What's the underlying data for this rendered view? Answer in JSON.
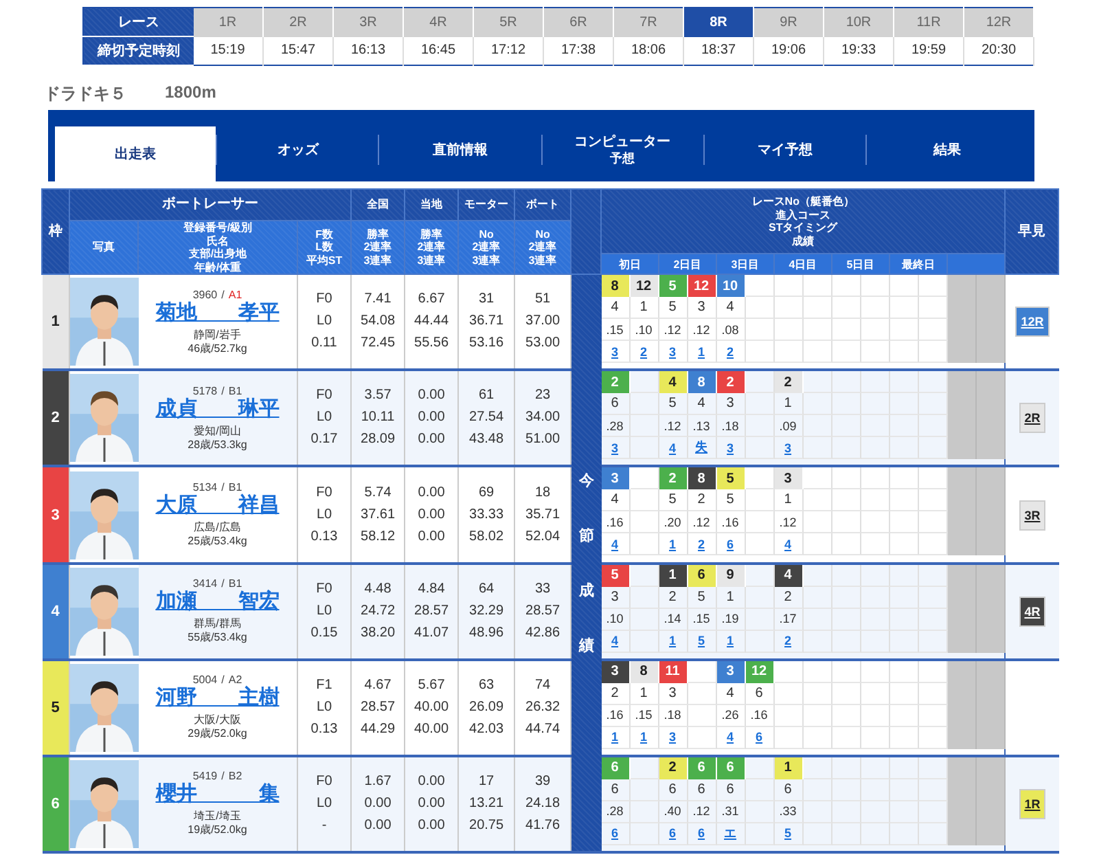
{
  "race_bar": {
    "race_label": "レース",
    "time_label": "締切予定時刻",
    "races": [
      {
        "label": "1R",
        "time": "15:19",
        "selected": false
      },
      {
        "label": "2R",
        "time": "15:47",
        "selected": false
      },
      {
        "label": "3R",
        "time": "16:13",
        "selected": false
      },
      {
        "label": "4R",
        "time": "16:45",
        "selected": false
      },
      {
        "label": "5R",
        "time": "17:12",
        "selected": false
      },
      {
        "label": "6R",
        "time": "17:38",
        "selected": false
      },
      {
        "label": "7R",
        "time": "18:06",
        "selected": false
      },
      {
        "label": "8R",
        "time": "18:37",
        "selected": true
      },
      {
        "label": "9R",
        "time": "19:06",
        "selected": false
      },
      {
        "label": "10R",
        "time": "19:33",
        "selected": false
      },
      {
        "label": "11R",
        "time": "19:59",
        "selected": false
      },
      {
        "label": "12R",
        "time": "20:30",
        "selected": false
      }
    ]
  },
  "race_title": {
    "name": "ドラドキ５",
    "distance": "1800m"
  },
  "tabs": [
    {
      "lines": [
        "出走表"
      ],
      "selected": true
    },
    {
      "lines": [
        "オッズ"
      ],
      "selected": false
    },
    {
      "lines": [
        "直前情報"
      ],
      "selected": false
    },
    {
      "lines": [
        "コンピューター",
        "予想"
      ],
      "selected": false
    },
    {
      "lines": [
        "マイ予想"
      ],
      "selected": false
    },
    {
      "lines": [
        "結果"
      ],
      "selected": false
    }
  ],
  "table": {
    "headers": {
      "waku": "枠",
      "racer": "ボートレーサー",
      "national": "全国",
      "local": "当地",
      "motor": "モーター",
      "boat": "ボート",
      "photo": "写真",
      "profile": [
        "登録番号/級別",
        "氏名",
        "支部/出身地",
        "年齢/体重"
      ],
      "fl": [
        "F数",
        "L数",
        "平均ST"
      ],
      "national_sub": [
        "勝率",
        "2連率",
        "3連率"
      ],
      "local_sub": [
        "勝率",
        "2連率",
        "3連率"
      ],
      "motor_sub": [
        "No",
        "2連率",
        "3連率"
      ],
      "boat_sub": [
        "No",
        "2連率",
        "3連率"
      ],
      "series": [
        "レースNo（艇番色）",
        "進入コース",
        "STタイミング",
        "成績"
      ],
      "days": [
        "初日",
        "2日目",
        "3日目",
        "4日目",
        "5日目",
        "最終日"
      ],
      "early": "早見"
    },
    "series_label": "今節成績",
    "racers": [
      {
        "waku": "1",
        "color": "#e6e6e6",
        "reg": "3960",
        "sep": "/",
        "klass": "A1",
        "klass_highlight": true,
        "name": "菊地　　孝平",
        "branch": "静岡/岩手",
        "age": "46歳/52.7kg",
        "fl": [
          "F0",
          "L0",
          "0.11"
        ],
        "national": [
          "7.41",
          "54.08",
          "72.45"
        ],
        "local": [
          "6.67",
          "44.44",
          "55.56"
        ],
        "motor": [
          "31",
          "36.71",
          "53.16"
        ],
        "boat": [
          "51",
          "37.00",
          "53.00"
        ],
        "races": [
          {
            "kind": "race",
            "no": "8",
            "color": "#e8e85a",
            "course": "4",
            "st": ".15",
            "result": "3"
          },
          {
            "kind": "race",
            "no": "12",
            "color": "#e6e6e6",
            "course": "1",
            "st": ".10",
            "result": "2"
          },
          {
            "kind": "race",
            "no": "5",
            "color": "#4cb04c",
            "course": "5",
            "st": ".12",
            "result": "3"
          },
          {
            "kind": "race",
            "no": "12",
            "color": "#e84444",
            "course": "3",
            "st": ".12",
            "result": "1"
          },
          {
            "kind": "race",
            "no": "10",
            "color": "#3f80d0",
            "course": "4",
            "st": ".08",
            "result": "2"
          }
        ],
        "early": {
          "label": "12R",
          "color": "#3f80d0"
        }
      },
      {
        "waku": "2",
        "color": "#444444",
        "reg": "5178",
        "sep": "/",
        "klass": "B1",
        "klass_highlight": false,
        "name": "成貞　　琳平",
        "branch": "愛知/岡山",
        "age": "28歳/53.3kg",
        "fl": [
          "F0",
          "L0",
          "0.17"
        ],
        "national": [
          "3.57",
          "10.11",
          "28.09"
        ],
        "local": [
          "0.00",
          "0.00",
          "0.00"
        ],
        "motor": [
          "61",
          "27.54",
          "43.48"
        ],
        "boat": [
          "23",
          "34.00",
          "51.00"
        ],
        "races": [
          {
            "kind": "race",
            "no": "2",
            "color": "#4cb04c",
            "course": "6",
            "st": ".28",
            "result": "3"
          },
          {
            "kind": "blank"
          },
          {
            "kind": "race",
            "no": "4",
            "color": "#e8e85a",
            "course": "5",
            "st": ".12",
            "result": "4"
          },
          {
            "kind": "race",
            "no": "8",
            "color": "#3f80d0",
            "course": "4",
            "st": ".13",
            "result": "失"
          },
          {
            "kind": "race",
            "no": "2",
            "color": "#e84444",
            "course": "3",
            "st": ".18",
            "result": "3"
          },
          {
            "kind": "blank"
          },
          {
            "kind": "race",
            "no": "2",
            "color": "#e6e6e6",
            "course": "1",
            "st": ".09",
            "result": "3"
          }
        ],
        "early": {
          "label": "2R",
          "color": "#e6e6e6"
        }
      },
      {
        "waku": "3",
        "color": "#e84444",
        "reg": "5134",
        "sep": "/",
        "klass": "B1",
        "klass_highlight": false,
        "name": "大原　　祥昌",
        "branch": "広島/広島",
        "age": "25歳/53.4kg",
        "fl": [
          "F0",
          "L0",
          "0.13"
        ],
        "national": [
          "5.74",
          "37.61",
          "58.12"
        ],
        "local": [
          "0.00",
          "0.00",
          "0.00"
        ],
        "motor": [
          "69",
          "33.33",
          "58.02"
        ],
        "boat": [
          "18",
          "35.71",
          "52.04"
        ],
        "races": [
          {
            "kind": "race",
            "no": "3",
            "color": "#3f80d0",
            "course": "4",
            "st": ".16",
            "result": "4"
          },
          {
            "kind": "blank"
          },
          {
            "kind": "race",
            "no": "2",
            "color": "#4cb04c",
            "course": "5",
            "st": ".20",
            "result": "1"
          },
          {
            "kind": "race",
            "no": "8",
            "color": "#444444",
            "course": "2",
            "st": ".12",
            "result": "2"
          },
          {
            "kind": "race",
            "no": "5",
            "color": "#e8e85a",
            "course": "5",
            "st": ".16",
            "result": "6"
          },
          {
            "kind": "blank"
          },
          {
            "kind": "race",
            "no": "3",
            "color": "#e6e6e6",
            "course": "1",
            "st": ".12",
            "result": "4"
          }
        ],
        "early": {
          "label": "3R",
          "color": "#e6e6e6"
        }
      },
      {
        "waku": "4",
        "color": "#3f80d0",
        "reg": "3414",
        "sep": "/",
        "klass": "B1",
        "klass_highlight": false,
        "name": "加瀬　　智宏",
        "branch": "群馬/群馬",
        "age": "55歳/53.4kg",
        "fl": [
          "F0",
          "L0",
          "0.15"
        ],
        "national": [
          "4.48",
          "24.72",
          "38.20"
        ],
        "local": [
          "4.84",
          "28.57",
          "41.07"
        ],
        "motor": [
          "64",
          "32.29",
          "48.96"
        ],
        "boat": [
          "33",
          "28.57",
          "42.86"
        ],
        "races": [
          {
            "kind": "race",
            "no": "5",
            "color": "#e84444",
            "course": "3",
            "st": ".10",
            "result": "4"
          },
          {
            "kind": "blank"
          },
          {
            "kind": "race",
            "no": "1",
            "color": "#444444",
            "course": "2",
            "st": ".14",
            "result": "1"
          },
          {
            "kind": "race",
            "no": "6",
            "color": "#e8e85a",
            "course": "5",
            "st": ".15",
            "result": "5"
          },
          {
            "kind": "race",
            "no": "9",
            "color": "#e6e6e6",
            "course": "1",
            "st": ".19",
            "result": "1"
          },
          {
            "kind": "blank"
          },
          {
            "kind": "race",
            "no": "4",
            "color": "#444444",
            "course": "2",
            "st": ".17",
            "result": "2"
          }
        ],
        "early": {
          "label": "4R",
          "color": "#444444"
        }
      },
      {
        "waku": "5",
        "color": "#e8e85a",
        "reg": "5004",
        "sep": "/",
        "klass": "A2",
        "klass_highlight": false,
        "name": "河野　　主樹",
        "branch": "大阪/大阪",
        "age": "29歳/52.0kg",
        "fl": [
          "F1",
          "L0",
          "0.13"
        ],
        "national": [
          "4.67",
          "28.57",
          "44.29"
        ],
        "local": [
          "5.67",
          "40.00",
          "40.00"
        ],
        "motor": [
          "63",
          "26.09",
          "42.03"
        ],
        "boat": [
          "74",
          "26.32",
          "44.74"
        ],
        "races": [
          {
            "kind": "race",
            "no": "3",
            "color": "#444444",
            "course": "2",
            "st": ".16",
            "result": "1"
          },
          {
            "kind": "race",
            "no": "8",
            "color": "#e6e6e6",
            "course": "1",
            "st": ".15",
            "result": "1"
          },
          {
            "kind": "race",
            "no": "11",
            "color": "#e84444",
            "course": "3",
            "st": ".18",
            "result": "3"
          },
          {
            "kind": "blank"
          },
          {
            "kind": "race",
            "no": "3",
            "color": "#3f80d0",
            "course": "4",
            "st": ".26",
            "result": "4"
          },
          {
            "kind": "race",
            "no": "12",
            "color": "#4cb04c",
            "course": "6",
            "st": ".16",
            "result": "6"
          }
        ]
      },
      {
        "waku": "6",
        "color": "#4cb04c",
        "reg": "5419",
        "sep": "/",
        "klass": "B2",
        "klass_highlight": false,
        "name": "櫻井　　　集",
        "branch": "埼玉/埼玉",
        "age": "19歳/52.0kg",
        "fl": [
          "F0",
          "L0",
          "-"
        ],
        "national": [
          "1.67",
          "0.00",
          "0.00"
        ],
        "local": [
          "0.00",
          "0.00",
          "0.00"
        ],
        "motor": [
          "17",
          "13.21",
          "20.75"
        ],
        "boat": [
          "39",
          "24.18",
          "41.76"
        ],
        "races": [
          {
            "kind": "race",
            "no": "6",
            "color": "#4cb04c",
            "course": "6",
            "st": ".28",
            "result": "6"
          },
          {
            "kind": "blank"
          },
          {
            "kind": "race",
            "no": "2",
            "color": "#e8e85a",
            "course": "6",
            "st": ".40",
            "result": "6"
          },
          {
            "kind": "race",
            "no": "6",
            "color": "#4cb04c",
            "course": "6",
            "st": ".12",
            "result": "6"
          },
          {
            "kind": "race",
            "no": "6",
            "color": "#4cb04c",
            "course": "6",
            "st": ".31",
            "result": "エ"
          },
          {
            "kind": "blank"
          },
          {
            "kind": "race",
            "no": "1",
            "color": "#e8e85a",
            "course": "6",
            "st": ".33",
            "result": "5"
          }
        ],
        "early": {
          "label": "1R",
          "color": "#e8e85a"
        }
      }
    ]
  }
}
